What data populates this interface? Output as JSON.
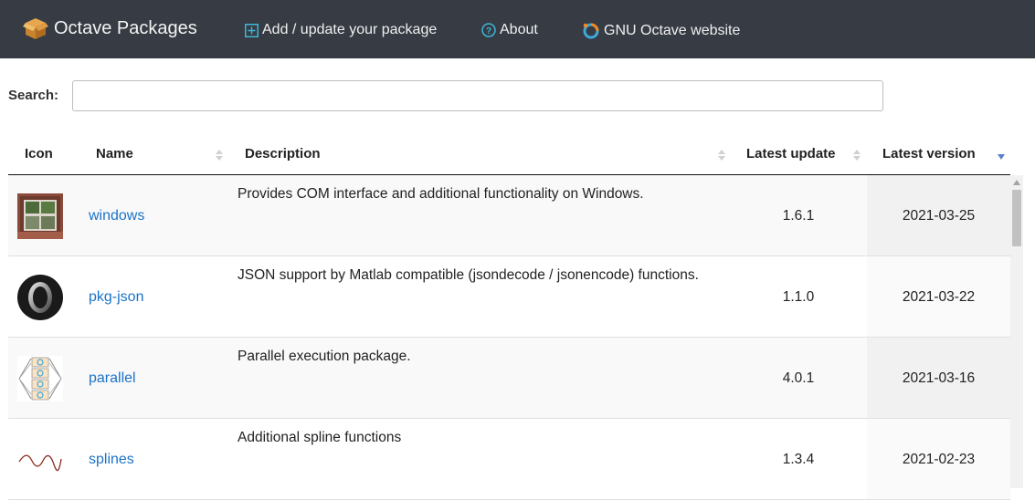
{
  "navbar": {
    "brand": "Octave Packages",
    "links": [
      {
        "label": "Add / update your package",
        "icon": "plus-square-icon"
      },
      {
        "label": "About",
        "icon": "question-circle-icon"
      },
      {
        "label": "GNU Octave website",
        "icon": "octave-logo-icon"
      }
    ],
    "background": "#363b44"
  },
  "search": {
    "label": "Search:",
    "value": "",
    "placeholder": ""
  },
  "table": {
    "columns": [
      "Icon",
      "Name",
      "Description",
      "Latest update",
      "Latest version"
    ],
    "sort_column": "Latest version",
    "sort_direction": "descending",
    "rows": [
      {
        "icon": "windows-package-icon",
        "name": "windows",
        "description": "Provides COM interface and additional functionality on Windows.",
        "latest_update": "1.6.1",
        "latest_version": "2021-03-25"
      },
      {
        "icon": "json-package-icon",
        "name": "pkg-json",
        "description": "JSON support by Matlab compatible (jsondecode / jsonencode) functions.",
        "latest_update": "1.1.0",
        "latest_version": "2021-03-22"
      },
      {
        "icon": "parallel-package-icon",
        "name": "parallel",
        "description": "Parallel execution package.",
        "latest_update": "4.0.1",
        "latest_version": "2021-03-16"
      },
      {
        "icon": "splines-package-icon",
        "name": "splines",
        "description": "Additional spline functions",
        "latest_update": "1.3.4",
        "latest_version": "2021-02-23"
      }
    ]
  },
  "colors": {
    "link": "#1a73c9",
    "accent_cyan": "#3fb6d6",
    "sort_active": "#5b7fd0"
  }
}
